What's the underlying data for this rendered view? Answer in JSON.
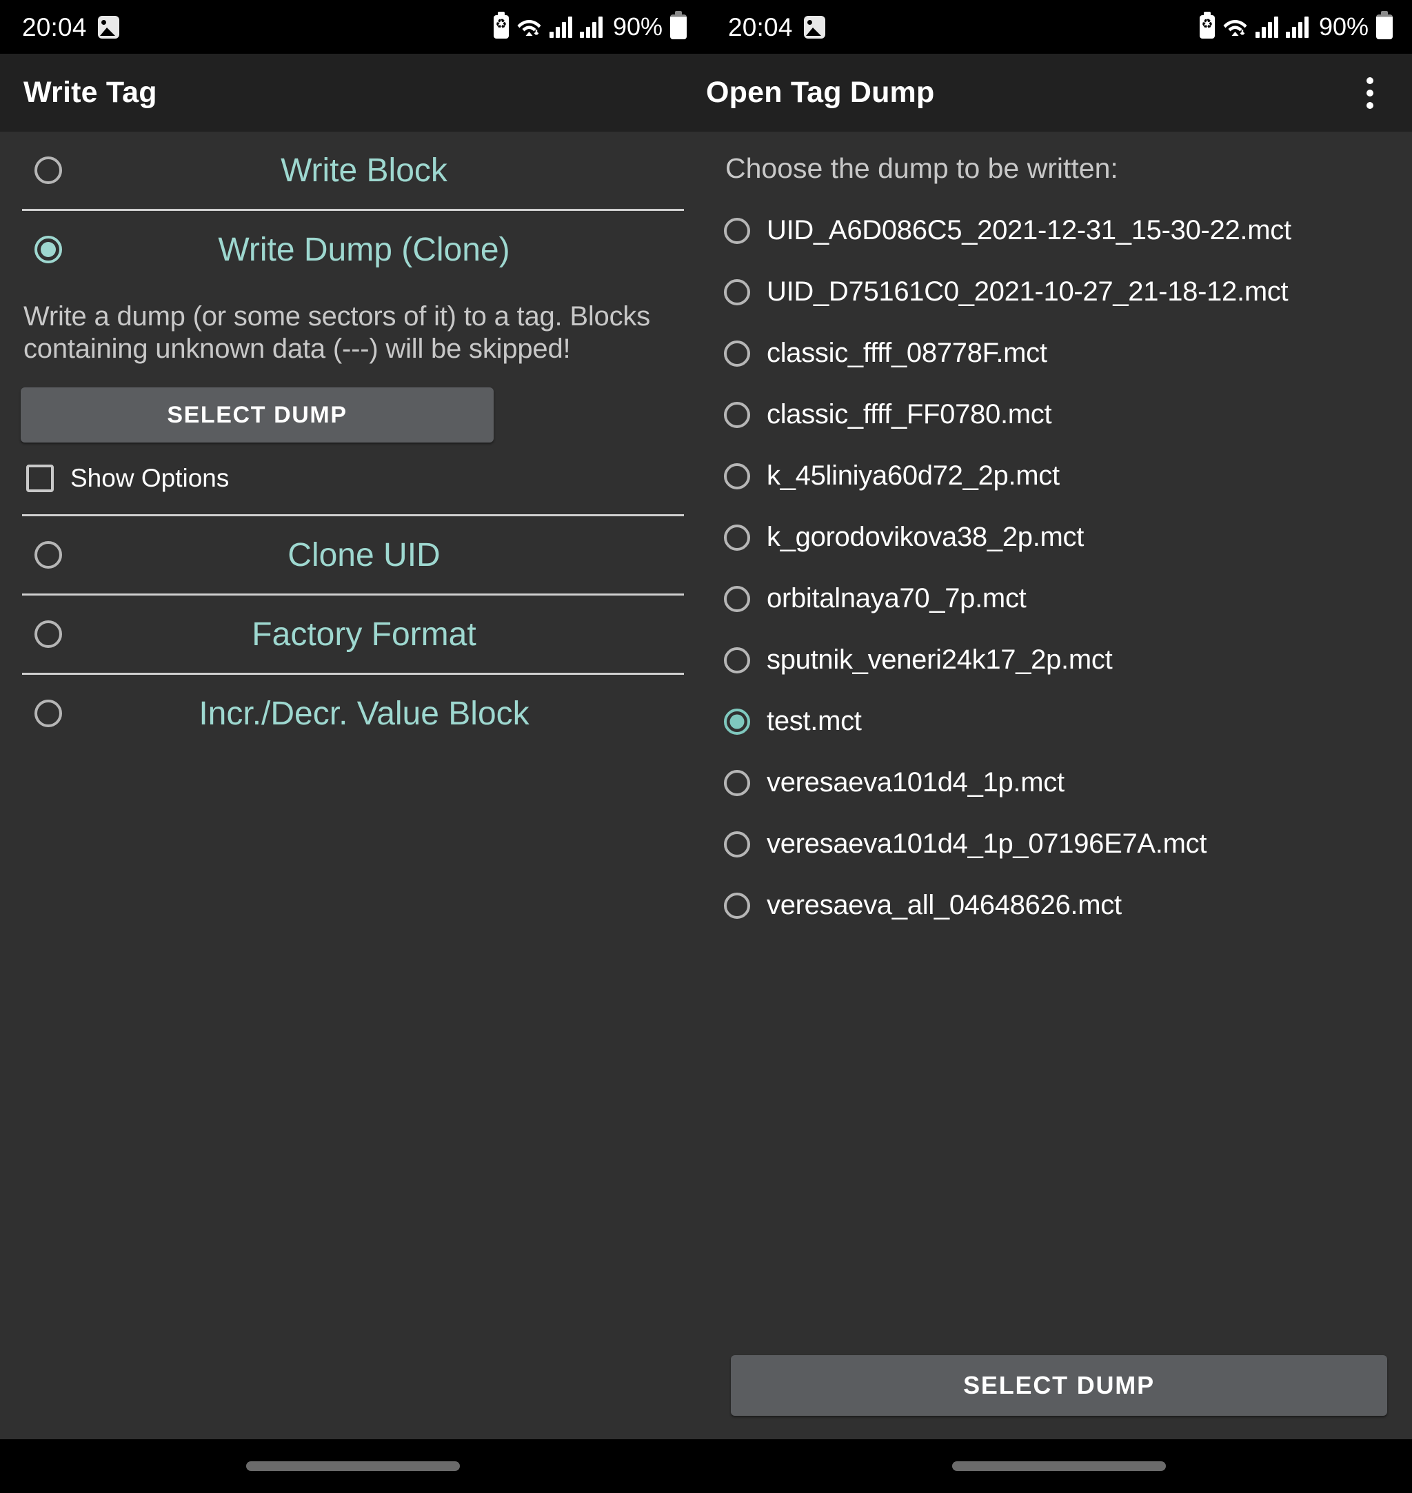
{
  "statusbar": {
    "time": "20:04",
    "battery_percent": "90%",
    "icons": [
      "photo-icon",
      "battery-saver-icon",
      "wifi-icon",
      "signal-bars-icon",
      "signal-bars-icon",
      "battery-icon"
    ]
  },
  "left": {
    "title": "Write Tag",
    "options": [
      {
        "label": "Write Block",
        "checked": false
      },
      {
        "label": "Write Dump (Clone)",
        "checked": true
      },
      {
        "label": "Clone UID",
        "checked": false
      },
      {
        "label": "Factory Format",
        "checked": false
      },
      {
        "label": "Incr./Decr. Value Block",
        "checked": false
      }
    ],
    "description": "Write a dump (or some sectors of it) to a tag. Blocks containing unknown data (---) will be skipped!",
    "select_dump_label": "SELECT DUMP",
    "show_options_label": "Show Options",
    "show_options_checked": false
  },
  "right": {
    "title": "Open Tag Dump",
    "overflow_menu": "more-options-icon",
    "prompt": "Choose the dump to be written:",
    "dumps": [
      {
        "name": "UID_A6D086C5_2021-12-31_15-30-22.mct",
        "checked": false
      },
      {
        "name": "UID_D75161C0_2021-10-27_21-18-12.mct",
        "checked": false
      },
      {
        "name": "classic_ffff_08778F.mct",
        "checked": false
      },
      {
        "name": "classic_ffff_FF0780.mct",
        "checked": false
      },
      {
        "name": "k_45liniya60d72_2p.mct",
        "checked": false
      },
      {
        "name": "k_gorodovikova38_2p.mct",
        "checked": false
      },
      {
        "name": "orbitalnaya70_7p.mct",
        "checked": false
      },
      {
        "name": "sputnik_veneri24k17_2p.mct",
        "checked": false
      },
      {
        "name": "test.mct",
        "checked": true
      },
      {
        "name": "veresaeva101d4_1p.mct",
        "checked": false
      },
      {
        "name": "veresaeva101d4_1p_07196E7A.mct",
        "checked": false
      },
      {
        "name": "veresaeva_all_04648626.mct",
        "checked": false
      }
    ],
    "select_dump_label": "SELECT DUMP"
  },
  "colors": {
    "accent_teal": "#9ed8d0",
    "app_bar": "#212121",
    "background": "#303030",
    "button_gray": "#5b5d60"
  }
}
